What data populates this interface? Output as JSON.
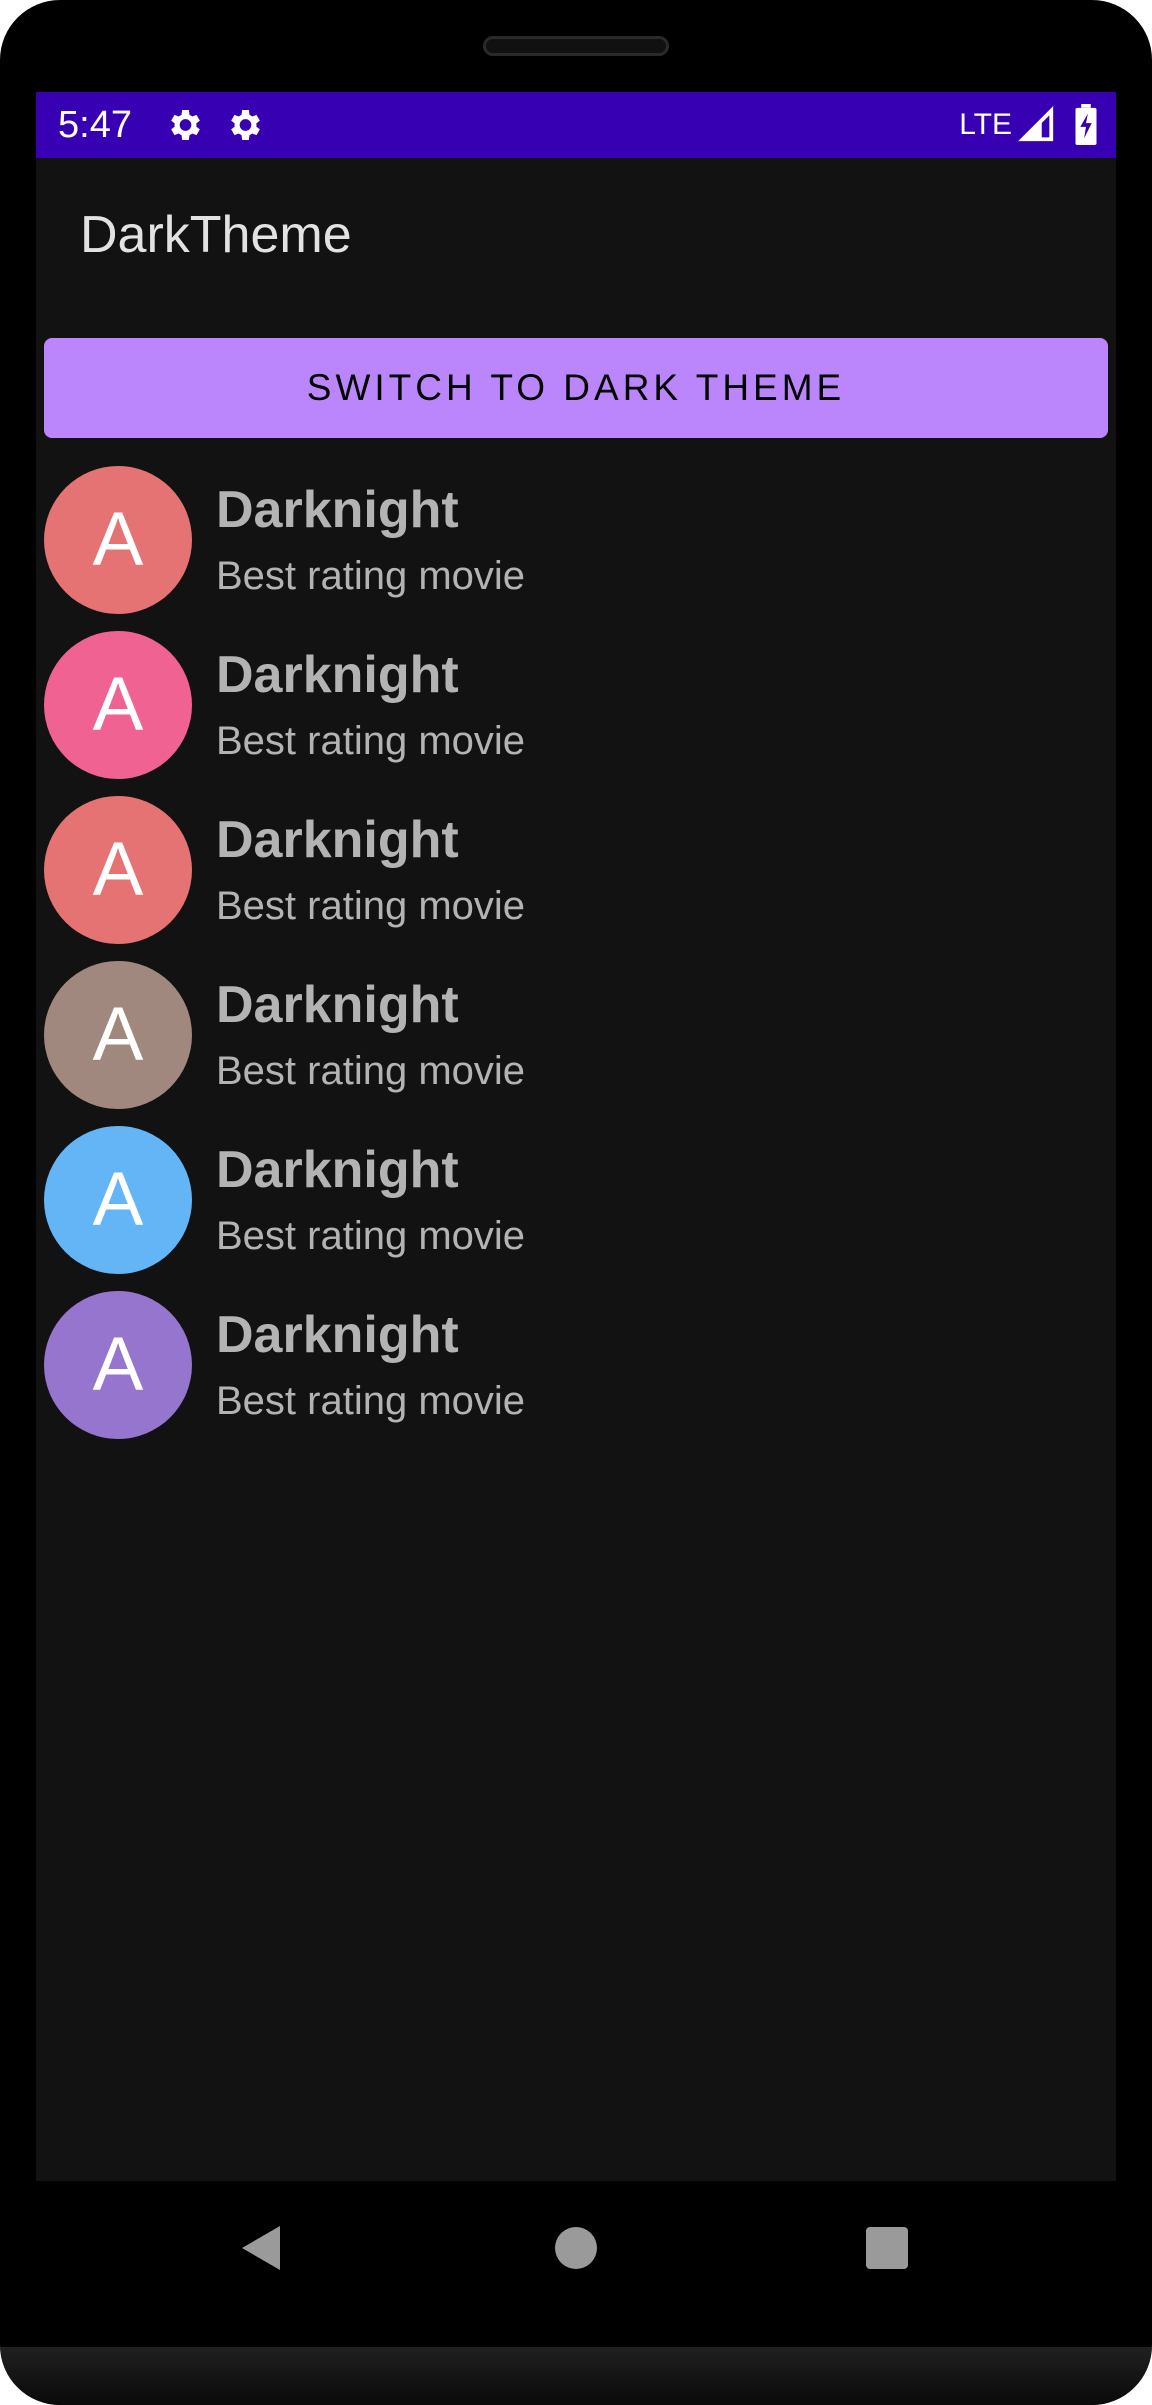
{
  "status_bar": {
    "time": "5:47",
    "network": "LTE",
    "icons": [
      "gear-icon",
      "gear-icon",
      "signal-icon",
      "battery-charging-icon"
    ],
    "background": "#3700b3"
  },
  "app": {
    "title": "DarkTheme"
  },
  "switch_button": {
    "label": "SWITCH TO DARK THEME",
    "color": "#bb86fc"
  },
  "movies": [
    {
      "avatar_letter": "A",
      "title": "Darknight",
      "subtitle": "Best rating movie",
      "avatar_color": "#e57373"
    },
    {
      "avatar_letter": "A",
      "title": "Darknight",
      "subtitle": "Best rating movie",
      "avatar_color": "#f06292"
    },
    {
      "avatar_letter": "A",
      "title": "Darknight",
      "subtitle": "Best rating movie",
      "avatar_color": "#e57373"
    },
    {
      "avatar_letter": "A",
      "title": "Darknight",
      "subtitle": "Best rating movie",
      "avatar_color": "#a1887f"
    },
    {
      "avatar_letter": "A",
      "title": "Darknight",
      "subtitle": "Best rating movie",
      "avatar_color": "#64b5f6"
    },
    {
      "avatar_letter": "A",
      "title": "Darknight",
      "subtitle": "Best rating movie",
      "avatar_color": "#9575cd"
    }
  ],
  "nav": {
    "icons": [
      "back-icon",
      "home-icon",
      "recents-icon"
    ]
  },
  "colors": {
    "screen_background": "#121212",
    "text_secondary": "#b3b3b3"
  }
}
